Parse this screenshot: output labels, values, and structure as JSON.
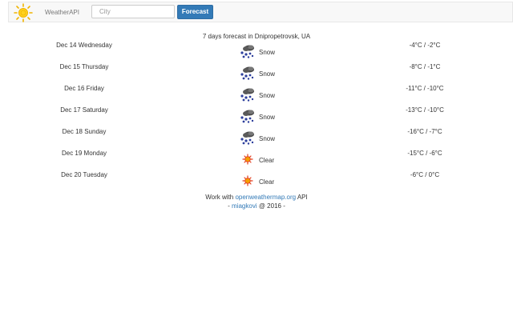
{
  "navbar": {
    "brand": "WeatherAPI",
    "logo_icon": "sun-icon",
    "search_placeholder": "City",
    "forecast_label": "Forecast"
  },
  "forecast": {
    "title": "7 days forecast in Dnipropetrovsk, UA",
    "days": [
      {
        "date": "Dec 14 Wednesday",
        "condition": "Snow",
        "icon": "snow-icon",
        "temp": "-4°C / -2°C"
      },
      {
        "date": "Dec 15 Thursday",
        "condition": "Snow",
        "icon": "snow-icon",
        "temp": "-8°C / -1°C"
      },
      {
        "date": "Dec 16 Friday",
        "condition": "Snow",
        "icon": "snow-icon",
        "temp": "-11°C / -10°C"
      },
      {
        "date": "Dec 17 Saturday",
        "condition": "Snow",
        "icon": "snow-icon",
        "temp": "-13°C / -10°C"
      },
      {
        "date": "Dec 18 Sunday",
        "condition": "Snow",
        "icon": "snow-icon",
        "temp": "-16°C / -7°C"
      },
      {
        "date": "Dec 19 Monday",
        "condition": "Clear",
        "icon": "clear-sun-icon",
        "temp": "-15°C / -6°C"
      },
      {
        "date": "Dec 20 Tuesday",
        "condition": "Clear",
        "icon": "clear-sun-icon",
        "temp": "-6°C / 0°C"
      }
    ]
  },
  "footer": {
    "line1_prefix": "Work with ",
    "line1_link": "openweathermap.org",
    "line1_suffix": " API",
    "line2_prefix": "- ",
    "line2_link": "miagkovi",
    "line2_suffix": " @ 2016 -"
  },
  "colors": {
    "accent": "#337ab7",
    "navbar_bg": "#f8f8f8"
  }
}
